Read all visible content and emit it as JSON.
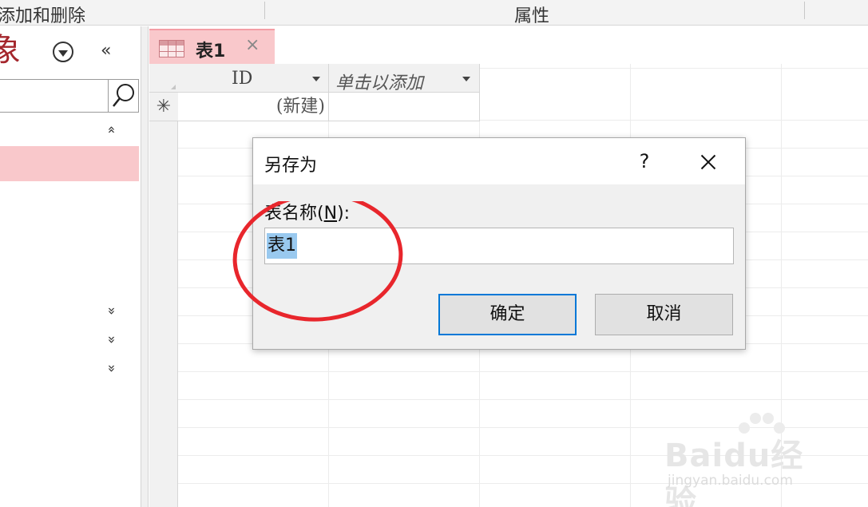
{
  "ribbon": {
    "group_add_delete": "添加和删除",
    "group_properties": "属性"
  },
  "nav_pane": {
    "title": "象",
    "collapse_symbol": "«",
    "group_expand_symbol": "»",
    "group_collapse_symbol": "«"
  },
  "document_tab": {
    "label": "表1",
    "close_symbol": "×"
  },
  "datasheet": {
    "columns": [
      {
        "label": "ID"
      },
      {
        "label": "单击以添加"
      }
    ],
    "new_row_marker": "✳",
    "new_row_value": "(新建)"
  },
  "dialog": {
    "title": "另存为",
    "help_symbol": "?",
    "field_label_prefix": "表名称(",
    "field_label_hotkey": "N",
    "field_label_suffix": "):",
    "input_value": "表1",
    "ok_label": "确定",
    "cancel_label": "取消"
  },
  "watermark": {
    "brand": "Baidu经验",
    "url": "jingyan.baidu.com"
  },
  "colors": {
    "tab_accent": "#f9c8cb",
    "title_red": "#a4262c",
    "primary_button_border": "#0078d7",
    "selection_highlight": "#99c9ef",
    "annotation_red": "#e8262c"
  }
}
